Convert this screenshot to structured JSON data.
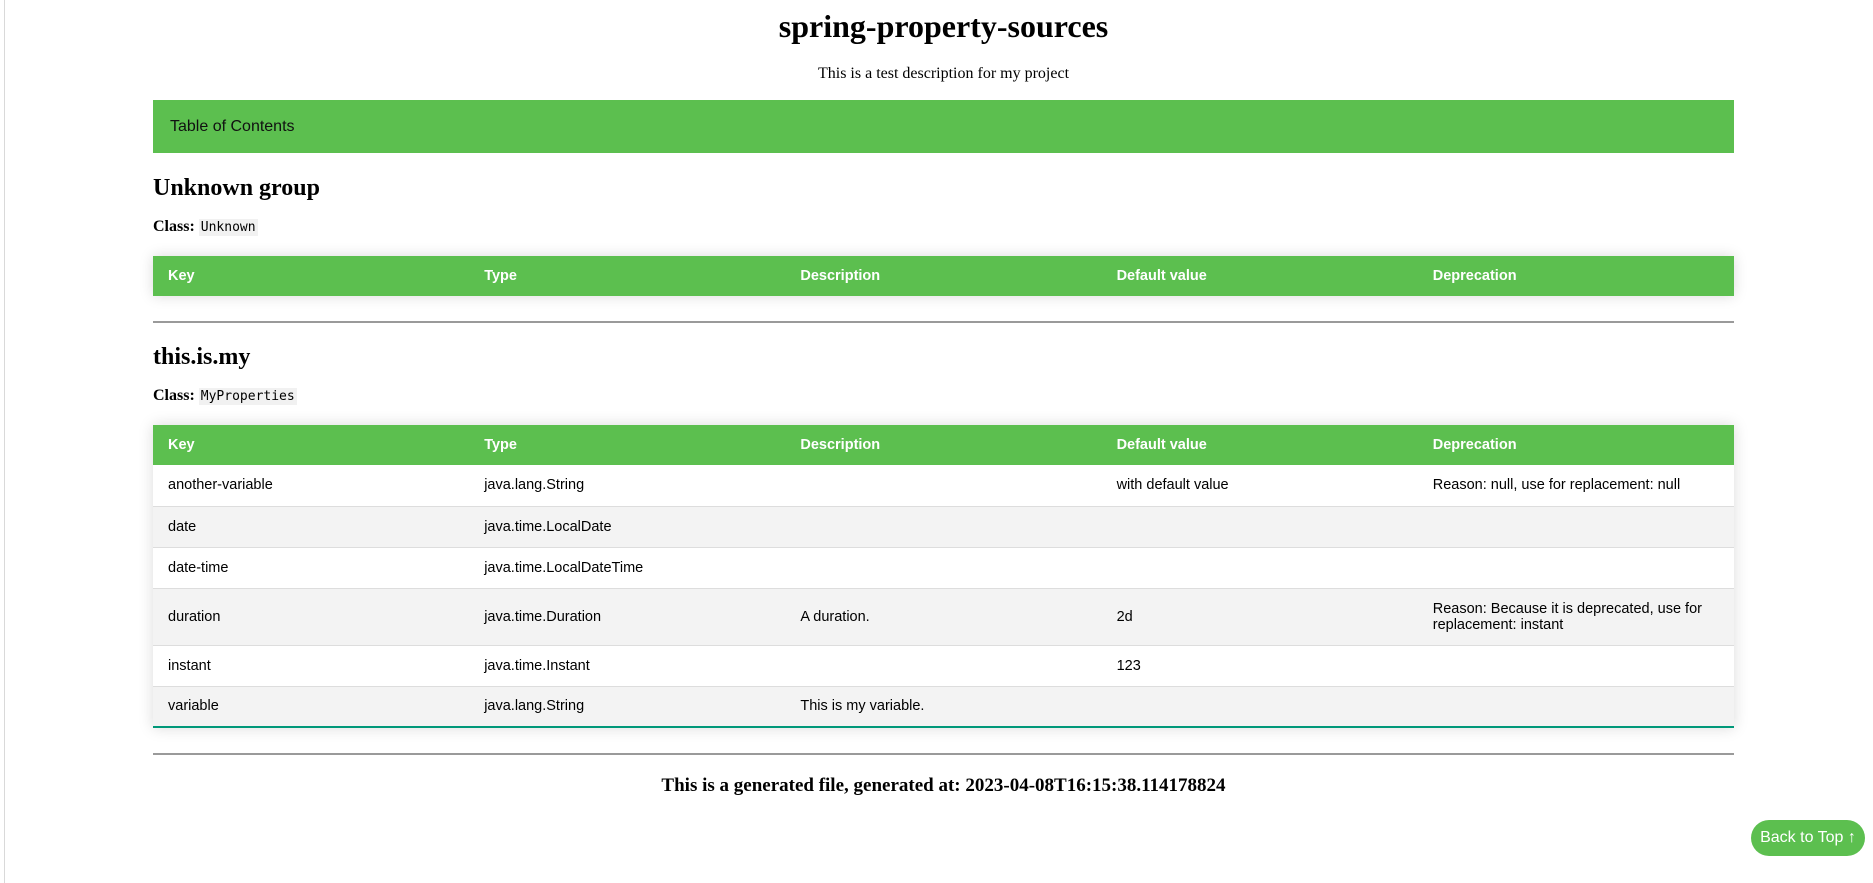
{
  "page": {
    "title": "spring-property-sources",
    "description": "This is a test description for my project",
    "toc_label": "Table of Contents"
  },
  "groups": [
    {
      "name": "Unknown group",
      "class_label": "Class:",
      "class_name": "Unknown",
      "headers": [
        "Key",
        "Type",
        "Description",
        "Default value",
        "Deprecation"
      ],
      "rows": []
    },
    {
      "name": "this.is.my",
      "class_label": "Class:",
      "class_name": "MyProperties",
      "headers": [
        "Key",
        "Type",
        "Description",
        "Default value",
        "Deprecation"
      ],
      "rows": [
        [
          "another-variable",
          "java.lang.String",
          "",
          "with default value",
          "Reason: null, use for replacement: null"
        ],
        [
          "date",
          "java.time.LocalDate",
          "",
          "",
          ""
        ],
        [
          "date-time",
          "java.time.LocalDateTime",
          "",
          "",
          ""
        ],
        [
          "duration",
          "java.time.Duration",
          "A duration.",
          "2d",
          "Reason: Because it is deprecated, use for replacement: instant"
        ],
        [
          "instant",
          "java.time.Instant",
          "",
          "123",
          ""
        ],
        [
          "variable",
          "java.lang.String",
          "This is my variable.",
          "",
          ""
        ]
      ]
    }
  ],
  "footer": {
    "generated_text": "This is a generated file, generated at: 2023-04-08T16:15:38.114178824"
  },
  "back_to_top": {
    "label": "Back to Top ↑"
  },
  "colors": {
    "accent": "#5cbf4f",
    "row_alt": "#f3f3f3",
    "last_row_border": "#009879"
  }
}
